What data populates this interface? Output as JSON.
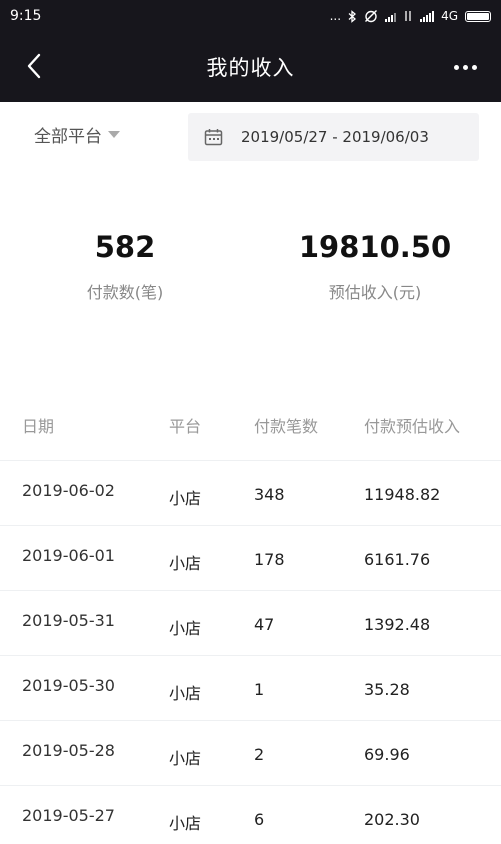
{
  "status": {
    "time": "9:15",
    "dots": "...",
    "network": "4G"
  },
  "header": {
    "title": "我的收入"
  },
  "filters": {
    "platform": "全部平台",
    "date_range": "2019/05/27 - 2019/06/03"
  },
  "summary": {
    "payments_value": "582",
    "payments_label": "付款数(笔)",
    "income_value": "19810.50",
    "income_label": "预估收入(元)"
  },
  "table": {
    "headers": [
      "日期",
      "平台",
      "付款笔数",
      "付款预估收入"
    ],
    "rows": [
      [
        "2019-06-02",
        "小店",
        "348",
        "11948.82"
      ],
      [
        "2019-06-01",
        "小店",
        "178",
        "6161.76"
      ],
      [
        "2019-05-31",
        "小店",
        "47",
        "1392.48"
      ],
      [
        "2019-05-30",
        "小店",
        "1",
        "35.28"
      ],
      [
        "2019-05-28",
        "小店",
        "2",
        "69.96"
      ],
      [
        "2019-05-27",
        "小店",
        "6",
        "202.30"
      ]
    ]
  }
}
